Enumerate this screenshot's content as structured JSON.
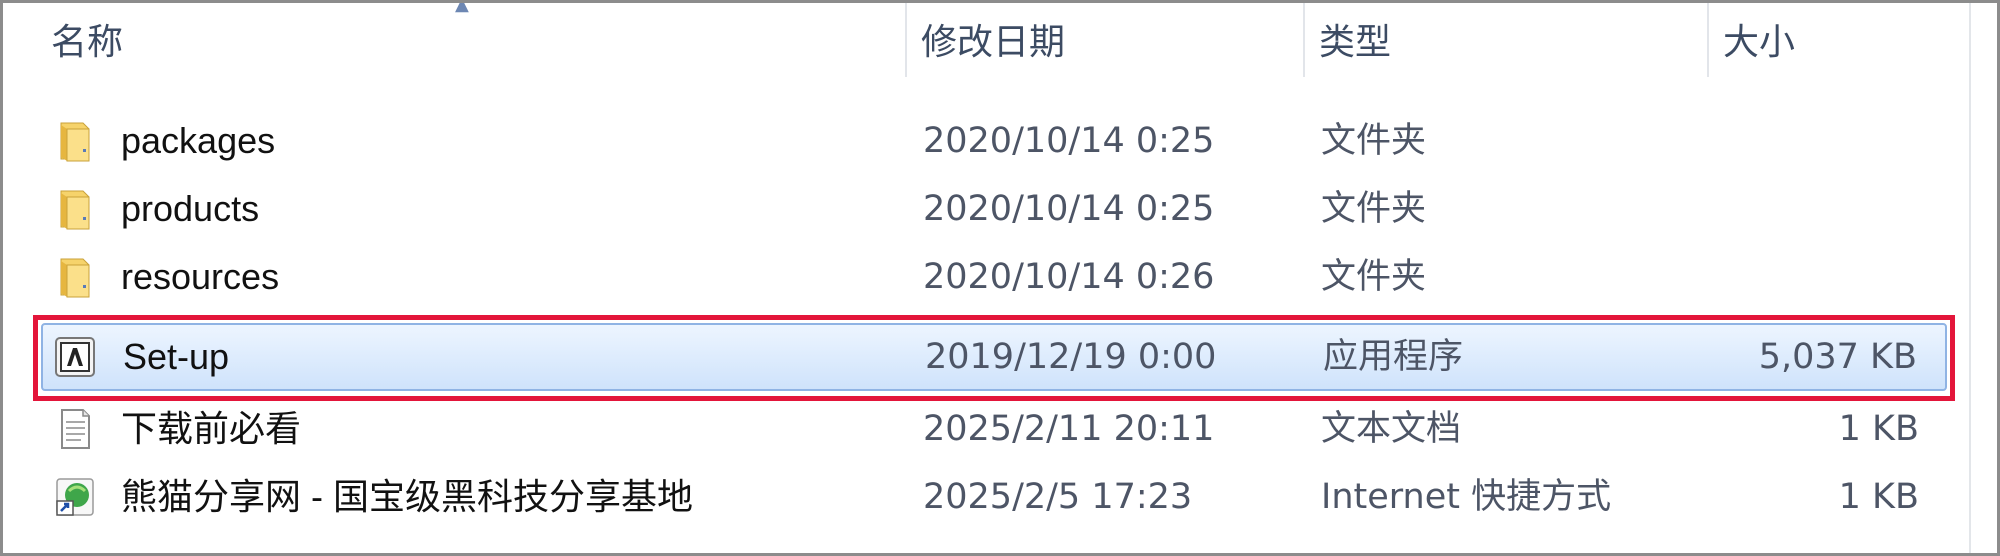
{
  "columns": {
    "name": "名称",
    "modified": "修改日期",
    "type": "类型",
    "size": "大小"
  },
  "rows": [
    {
      "name": "packages",
      "date": "2020/10/14 0:25",
      "type": "文件夹",
      "size": "",
      "icon": "folder-icon"
    },
    {
      "name": "products",
      "date": "2020/10/14 0:25",
      "type": "文件夹",
      "size": "",
      "icon": "folder-icon"
    },
    {
      "name": "resources",
      "date": "2020/10/14 0:26",
      "type": "文件夹",
      "size": "",
      "icon": "folder-icon"
    },
    {
      "name": "Set-up",
      "date": "2019/12/19 0:00",
      "type": "应用程序",
      "size": "5,037 KB",
      "icon": "adobe-app-icon",
      "selected": true
    },
    {
      "name": "下载前必看",
      "date": "2025/2/11 20:11",
      "type": "文本文档",
      "size": "1 KB",
      "icon": "text-document-icon"
    },
    {
      "name": "熊猫分享网 - 国宝级黑科技分享基地",
      "date": "2025/2/5 17:23",
      "type": "Internet 快捷方式",
      "size": "1 KB",
      "icon": "internet-shortcut-icon"
    }
  ],
  "colors": {
    "highlight": "#e3153a",
    "selection": "#cfe3fb",
    "folder": "#f2c94c"
  }
}
